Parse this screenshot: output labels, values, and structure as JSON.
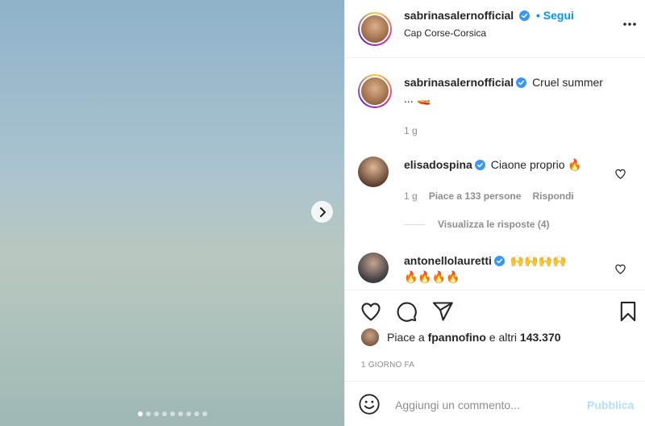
{
  "media": {
    "placeholder": "",
    "slides": 9,
    "active_slide": 0
  },
  "header": {
    "username": "sabrinasalernofficial",
    "follow_label": "• Segui",
    "location": "Cap Corse-Corsica"
  },
  "caption": {
    "username": "sabrinasalernofficial",
    "text": "Cruel summer",
    "text2": "... 🚤",
    "time": "1 g"
  },
  "comments": [
    {
      "username": "elisadospina",
      "text": "Ciaone proprio 🔥",
      "time": "1 g",
      "likes": "Piace a 133 persone",
      "reply": "Rispondi"
    },
    {
      "username": "antonellolauretti",
      "text": "🙌🙌🙌🙌",
      "text2": "🔥🔥🔥🔥"
    }
  ],
  "view_replies": "Visualizza le risposte (4)",
  "likes": {
    "prefix": "Piace a ",
    "user": "fpannofino",
    "middle": " e altri ",
    "count": "143.370"
  },
  "timestamp": "1 GIORNO FA",
  "add_comment": {
    "placeholder": "Aggiungi un commento...",
    "publish": "Pubblica"
  },
  "colors": {
    "accent": "#0095f6",
    "verified": "#3897f0",
    "publish_disabled": "#b2dffc",
    "muted": "#8e8e8e"
  }
}
